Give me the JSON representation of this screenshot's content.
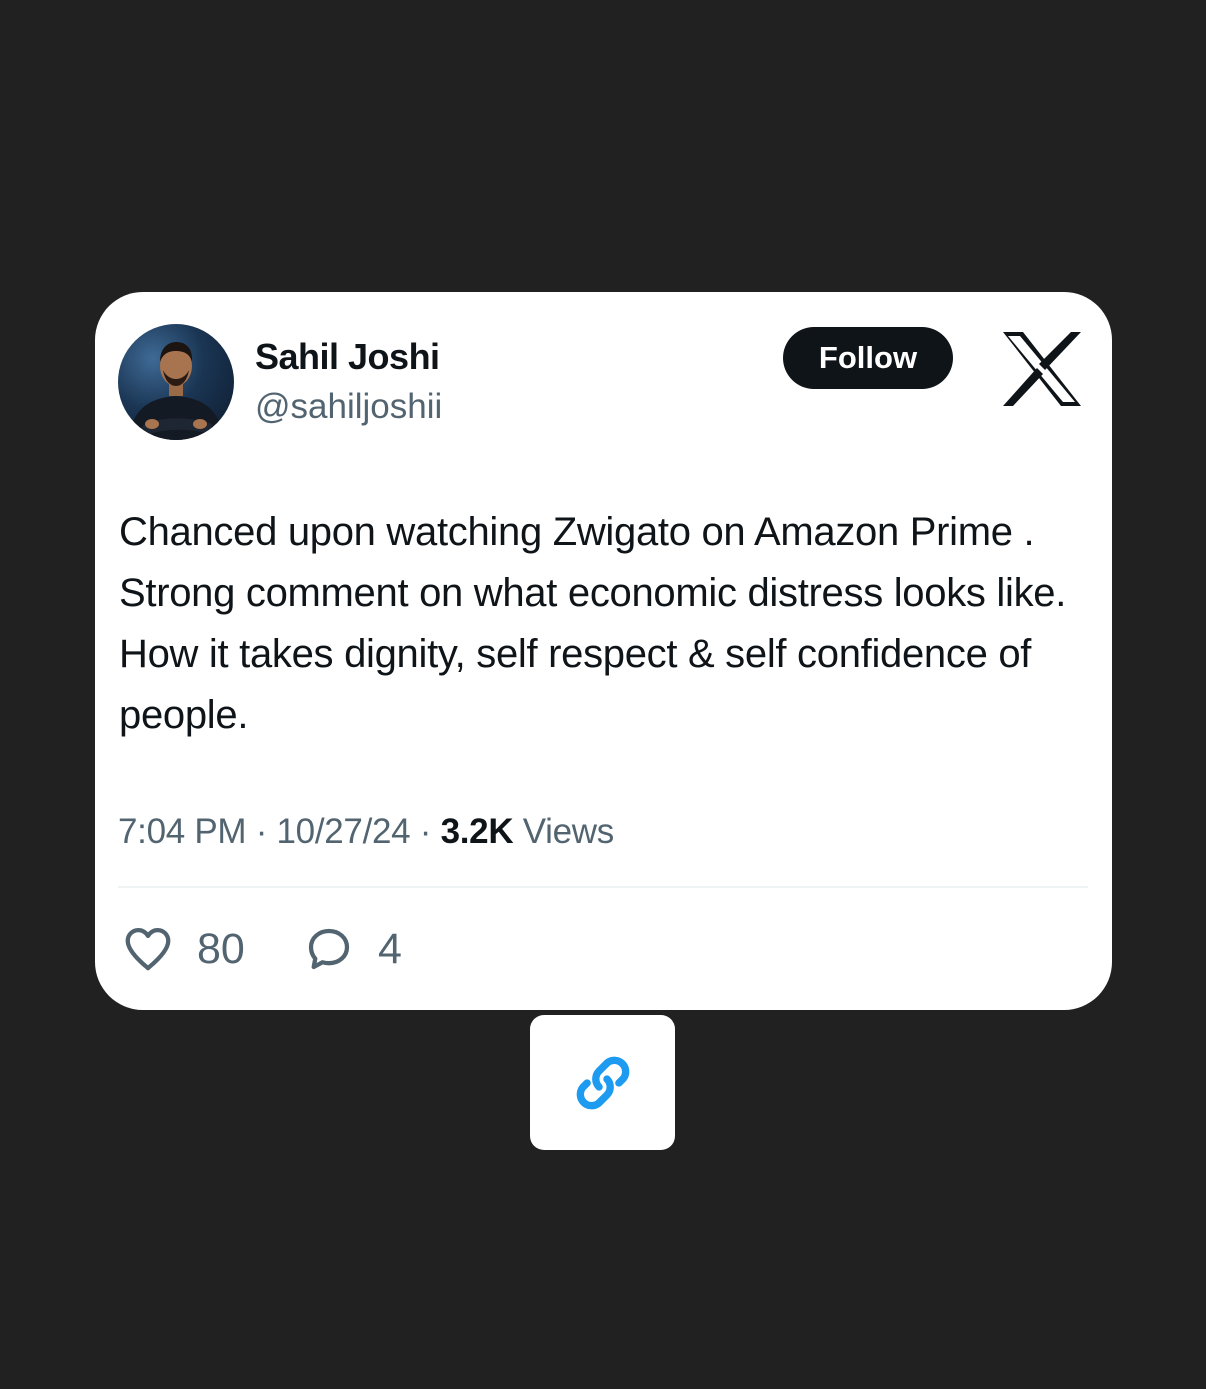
{
  "tweet": {
    "author": {
      "name": "Sahil Joshi",
      "handle": "@sahiljoshii"
    },
    "follow_label": "Follow",
    "text": "Chanced upon watching Zwigato on Amazon Prime . Strong comment on what economic distress looks like. How it takes dignity, self respect & self confidence of people.",
    "time": "7:04 PM",
    "date": "10/27/24",
    "separator": "·",
    "views_count": "3.2K",
    "views_label": "Views",
    "likes": "80",
    "replies": "4"
  },
  "icons": {
    "brand": "x-logo-icon",
    "like": "heart-icon",
    "reply": "speech-bubble-icon",
    "link": "link-icon"
  },
  "colors": {
    "background": "#212121",
    "card": "#ffffff",
    "text_primary": "#0f1419",
    "text_secondary": "#536471",
    "link_accent": "#1d9bf0"
  }
}
